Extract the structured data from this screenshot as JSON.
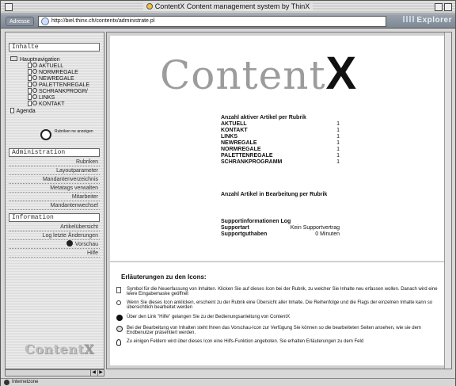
{
  "window": {
    "title": "ContentX Content management system by ThinX"
  },
  "addressbar": {
    "label": "Adresse",
    "url": "http://biel.thinx.ch/contentx/administrate.pl",
    "browser": "Explorer"
  },
  "sidebar": {
    "inhalte": {
      "heading": "Inhalte",
      "root": "Hauptnavigation",
      "items": [
        "AKTUELL",
        "NORMREGALE",
        "NEWREGALE",
        "PALETTENREGALE",
        "SCHRANKPROGR/",
        "LINKS",
        "KONTAKT"
      ],
      "agenda": "Agenda",
      "refresh_label": "Rubriken ne anzeigen"
    },
    "administration": {
      "heading": "Administration",
      "items": [
        "Rubriken",
        "Layoutparameter",
        "Mandantenverzeichnis",
        "Metatags verwalten",
        "Mitarbeiter",
        "Mandantenwechsel"
      ]
    },
    "information": {
      "heading": "Information",
      "items": [
        "Artikelübersicht",
        "Log letzte Änderungen",
        "Vorschau",
        "Hilfe"
      ]
    },
    "logo_text": "Content",
    "logo_x": "X"
  },
  "main": {
    "logo_text": "Content",
    "logo_x": "X",
    "active_heading": "Anzahl aktiver Artikel per Rubrik",
    "active_rows": [
      {
        "k": "AKTUELL",
        "v": "1"
      },
      {
        "k": "KONTAKT",
        "v": "1"
      },
      {
        "k": "LINKS",
        "v": "1"
      },
      {
        "k": "NEWREGALE",
        "v": "1"
      },
      {
        "k": "NORMREGALE",
        "v": "1"
      },
      {
        "k": "PALETTENREGALE",
        "v": "1"
      },
      {
        "k": "SCHRANKPROGRAMM",
        "v": "1"
      }
    ],
    "editing_heading": "Anzahl Artikel in Bearbeitung per Rubrik",
    "support_heading": "Supportinformationen Log",
    "support_rows": [
      {
        "k": "Supportart",
        "v": "Kein Supportvertrag"
      },
      {
        "k": "Supportguthaben",
        "v": "0 Minuten"
      }
    ],
    "icons_title": "Erläuterungen zu den Icons:",
    "icons": [
      {
        "icon": "new-document-icon",
        "text": "Symbol für die Neuerfassung von Inhalten. Klicken Sie auf dieses Icon bei der Rubrik, zu welcher Sie Inhalte neu erfassen wollen. Danach wird eine leere Eingabemaske geöffnet"
      },
      {
        "icon": "magnifier-icon",
        "text": "Wenn Sie dieses Icon anklicken, erscheint zu der Rubrik eine Übersicht aller Inhalte. Die Reihenfolge und die Flags der einzelnen Inhalte kann so übersichtlich bearbeitet werden"
      },
      {
        "icon": "help-icon",
        "text": "Über den Link \"Hilfe\" gelangen Sie zu der Bedienungsanleitung von ContentX"
      },
      {
        "icon": "preview-icon",
        "text": "Bei der Bearbeitung von Inhalten steht Ihnen das Vorschau-Icon zur Verfügung Sie können so die bearbeiteten Seiten ansehen, wie sie dem Endbenutzer präsentiert werden."
      },
      {
        "icon": "bulb-icon",
        "text": "Zu einigen Feldern wird über dieses Icon eine Hilfs-Funktion angeboten. Sie erhalten Erläuterungen zu dem Feld"
      }
    ]
  },
  "statusbar": {
    "zone": "Internetzone"
  }
}
